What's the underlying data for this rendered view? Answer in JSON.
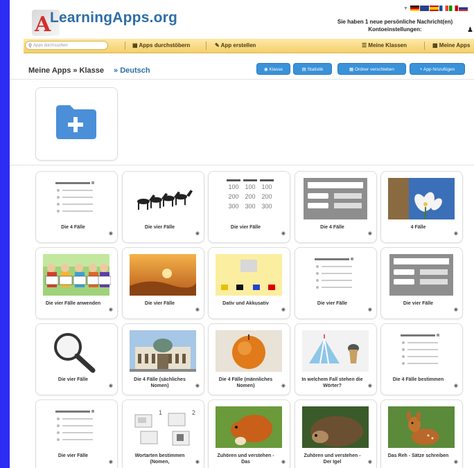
{
  "header": {
    "logo_text": "LearningApps.org",
    "message_line1": "Sie haben 1 neue persönliche Nachricht(en)",
    "message_line2": "Kontoeinstellungen:"
  },
  "nav": {
    "search_placeholder": "Apps durchsuchen",
    "items": [
      "Apps durchstöbern",
      "App erstellen",
      "Meine Klassen",
      "Meine Apps"
    ]
  },
  "breadcrumb": {
    "path": "Meine Apps » Klasse",
    "current": "» Deutsch"
  },
  "toolbar": {
    "buttons": [
      "Klasse",
      "Statistik",
      "Ordner verschieben",
      "App hinzufügen"
    ]
  },
  "apps": [
    {
      "title": "Die 4 Fälle",
      "thumb": "list-quiz"
    },
    {
      "title": "Die vier Fälle",
      "thumb": "horses"
    },
    {
      "title": "Die vier Fälle",
      "thumb": "number-grid"
    },
    {
      "title": "Die 4 Fälle",
      "thumb": "form-grey"
    },
    {
      "title": "4 Fälle",
      "thumb": "flowers"
    },
    {
      "title": "Die vier Fälle anwenden",
      "thumb": "kids"
    },
    {
      "title": "Die vier Fälle",
      "thumb": "desert"
    },
    {
      "title": "Dativ und Akkusativ",
      "thumb": "color-squares"
    },
    {
      "title": "Die vier Fälle",
      "thumb": "list-quiz"
    },
    {
      "title": "Die vier Fälle",
      "thumb": "form-grey"
    },
    {
      "title": "Die vier Fälle",
      "thumb": "magnifier"
    },
    {
      "title": "Die 4 Fälle (sächliches Nomen)",
      "thumb": "building"
    },
    {
      "title": "Die 4 Fälle (männliches Nomen)",
      "thumb": "apple"
    },
    {
      "title": "In welchem Fall stehen die Wörter?",
      "thumb": "circus"
    },
    {
      "title": "Die 4 Fälle bestimmen",
      "thumb": "list-quiz"
    },
    {
      "title": "Die vier Fälle",
      "thumb": "list-quiz"
    },
    {
      "title": "Wortarten bestimmen (Nomen,",
      "thumb": "cards-12"
    },
    {
      "title": "Zuhören und verstehen - Das",
      "thumb": "squirrel"
    },
    {
      "title": "Zuhören und verstehen - Der Igel",
      "thumb": "hedgehog"
    },
    {
      "title": "Das Reh - Sätze schreiben",
      "thumb": "deer"
    }
  ],
  "number_grid": [
    "100",
    "100",
    "100",
    "200",
    "200",
    "200",
    "300",
    "300",
    "300"
  ],
  "cards_numbers": [
    "1",
    "2"
  ],
  "colors": {
    "accent": "#3a92d8",
    "nav_bg": "#f5cf6a",
    "folder": "#4a8fd8"
  }
}
